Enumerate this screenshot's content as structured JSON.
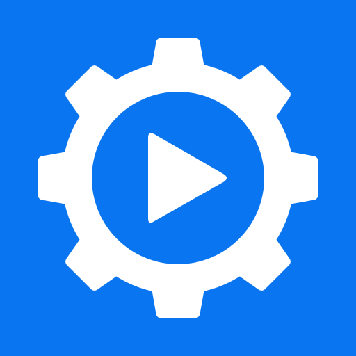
{
  "app_icon": {
    "icon_name": "gear-play-icon",
    "parts": {
      "gear": "gear-icon",
      "play": "play-icon"
    },
    "colors": {
      "background": "#0a75f0",
      "gear": "#ffffff",
      "inner_circle": "#0a75f0",
      "play": "#ffffff"
    },
    "gear_teeth": 8
  }
}
